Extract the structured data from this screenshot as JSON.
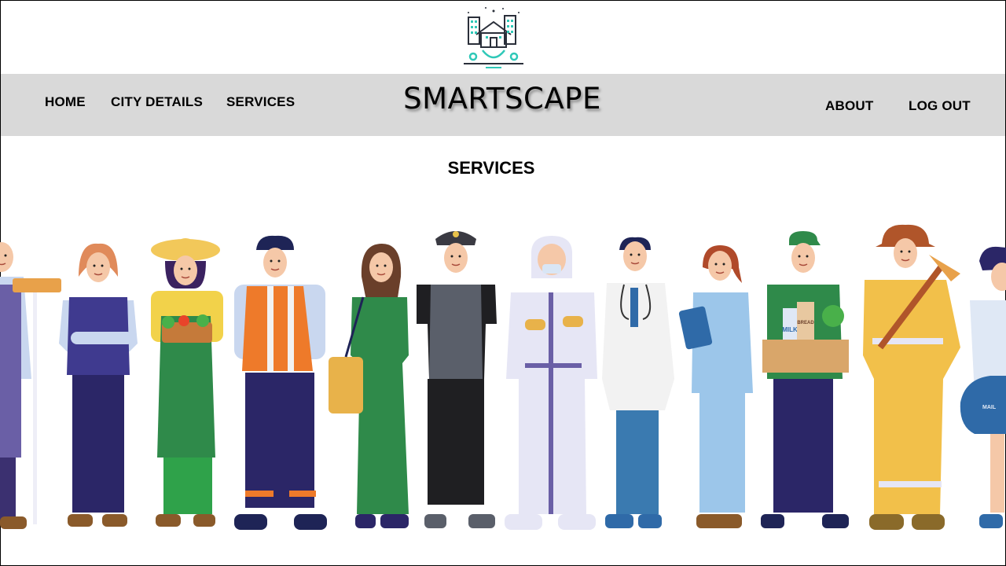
{
  "nav": {
    "home": "HOME",
    "city_details": "CITY DETAILS",
    "services": "SERVICES",
    "about": "ABOUT",
    "logout": "LOG OUT"
  },
  "brand": "SMARTSCAPE",
  "page_title": "SERVICES",
  "colors": {
    "nav_bg": "#d9d9d9",
    "accent": "#2fc8b8"
  },
  "icons": {
    "logo": "smart-city-house-gear-icon"
  },
  "illustration": {
    "workers": [
      "cleaner",
      "office-worker",
      "farmer",
      "construction-worker",
      "vet",
      "police-officer",
      "hazmat-worker",
      "doctor",
      "nurse",
      "grocer",
      "firefighter",
      "mail-carrier"
    ],
    "text": {
      "grocer_milk": "MILK",
      "grocer_bread": "BREAD",
      "mail_bag": "MAIL"
    }
  }
}
